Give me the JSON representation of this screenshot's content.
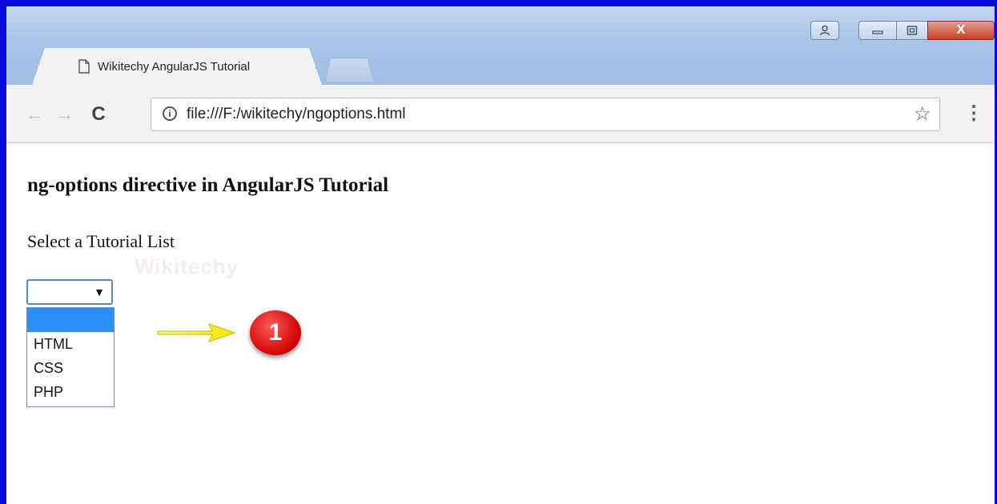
{
  "browser": {
    "tab": {
      "title": "Wikitechy AngularJS Tutorial",
      "close": "✕"
    },
    "window_controls": {
      "user": "👤",
      "minimize": "▭",
      "maximize": "▢",
      "close": "X"
    },
    "toolbar": {
      "back": "←",
      "forward": "→",
      "reload": "C",
      "url": "file:///F:/wikitechy/ngoptions.html",
      "star": "☆",
      "menu": "⋮"
    }
  },
  "page": {
    "heading": "ng-options directive in AngularJS Tutorial",
    "label": "Select a Tutorial List",
    "select": {
      "value": "",
      "options": [
        "",
        "HTML",
        "CSS",
        "PHP"
      ]
    },
    "watermark": "Wikitechy",
    "callout_number": "1"
  }
}
